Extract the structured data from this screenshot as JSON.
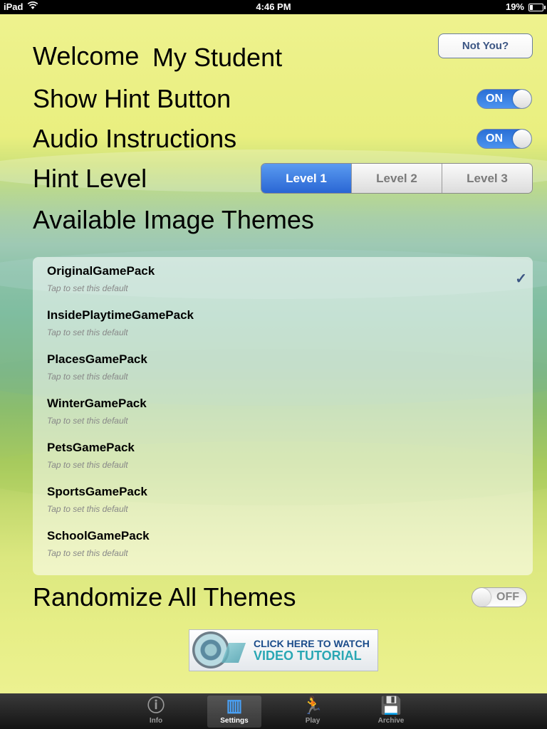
{
  "status_bar": {
    "device": "iPad",
    "time": "4:46 PM",
    "battery": "19%"
  },
  "welcome": {
    "label": "Welcome",
    "name": "My Student",
    "not_you_button": "Not You?"
  },
  "settings": {
    "show_hint": {
      "label": "Show Hint Button",
      "toggle": "ON"
    },
    "audio": {
      "label": "Audio Instructions",
      "toggle": "ON"
    },
    "hint_level": {
      "label": "Hint Level",
      "segments": [
        "Level 1",
        "Level 2",
        "Level 3"
      ],
      "selected": "Level 1"
    },
    "themes_title": "Available Image Themes",
    "randomize": {
      "label": "Randomize All Themes",
      "toggle": "OFF"
    }
  },
  "themes": [
    {
      "name": "OriginalGamePack",
      "subtitle": "Tap to set this default",
      "checked": true
    },
    {
      "name": "InsidePlaytimeGamePack",
      "subtitle": "Tap to set this default",
      "checked": false
    },
    {
      "name": "PlacesGamePack",
      "subtitle": "Tap to set this default",
      "checked": false
    },
    {
      "name": "WinterGamePack",
      "subtitle": "Tap to set this default",
      "checked": false
    },
    {
      "name": "PetsGamePack",
      "subtitle": "Tap to set this default",
      "checked": false
    },
    {
      "name": "SportsGamePack",
      "subtitle": "Tap to set this default",
      "checked": false
    },
    {
      "name": "SchoolGamePack",
      "subtitle": "Tap to set this default",
      "checked": false
    }
  ],
  "check_mark": "✓",
  "video_banner": {
    "line1": "CLICK HERE TO WATCH",
    "line2": "VIDEO TUTORIAL"
  },
  "tabs": [
    {
      "label": "Info",
      "icon": "info-icon",
      "glyph": "ⓘ"
    },
    {
      "label": "Settings",
      "icon": "equalizer-bars-icon",
      "glyph": "▥",
      "active": true
    },
    {
      "label": "Play",
      "icon": "running-figure-icon",
      "glyph": "🏃"
    },
    {
      "label": "Archive",
      "icon": "floppy-disk-icon",
      "glyph": "💾"
    }
  ],
  "colors": {
    "accent": "#2a6fd6",
    "link": "#3b5583"
  }
}
